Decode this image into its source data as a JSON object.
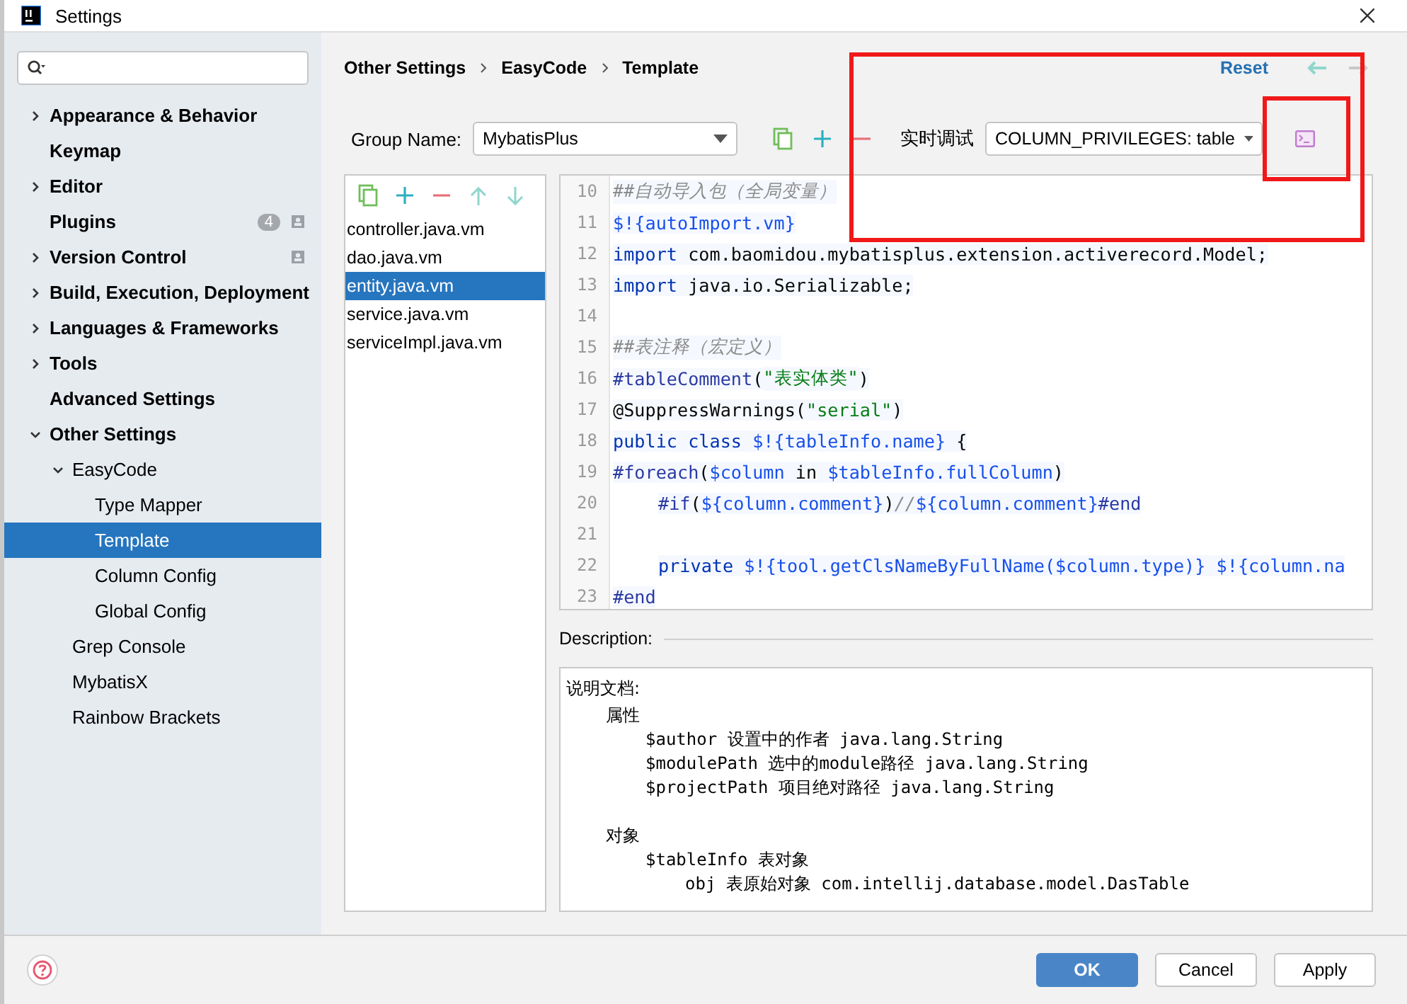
{
  "window": {
    "title": "Settings"
  },
  "sidebar": {
    "items": [
      {
        "label": "Appearance & Behavior",
        "expanded": false,
        "selected": false
      },
      {
        "label": "Keymap",
        "selected": false
      },
      {
        "label": "Editor",
        "expanded": false,
        "selected": false
      },
      {
        "label": "Plugins",
        "selected": false,
        "scoped": true,
        "badge": "4"
      },
      {
        "label": "Version Control",
        "expanded": false,
        "selected": false,
        "scoped": true
      },
      {
        "label": "Build, Execution, Deployment",
        "expanded": false,
        "selected": false
      },
      {
        "label": "Languages & Frameworks",
        "expanded": false,
        "selected": false
      },
      {
        "label": "Tools",
        "expanded": false,
        "selected": false
      },
      {
        "label": "Advanced Settings",
        "selected": false
      },
      {
        "label": "Other Settings",
        "expanded": true,
        "selected": false,
        "children": [
          {
            "label": "EasyCode",
            "expanded": true,
            "selected": false,
            "children": [
              {
                "label": "Type Mapper",
                "selected": false
              },
              {
                "label": "Template",
                "selected": true
              },
              {
                "label": "Column Config",
                "selected": false
              },
              {
                "label": "Global Config",
                "selected": false
              }
            ]
          },
          {
            "label": "Grep Console",
            "selected": false
          },
          {
            "label": "MybatisX",
            "selected": false
          },
          {
            "label": "Rainbow Brackets",
            "selected": false
          }
        ]
      }
    ]
  },
  "breadcrumb": [
    "Other Settings",
    "EasyCode",
    "Template"
  ],
  "reset": "Reset",
  "group": {
    "label": "Group Name:",
    "value": "MybatisPlus"
  },
  "debug": {
    "label": "实时调试",
    "value": "COLUMN_PRIVILEGES: table",
    "highlighted": true,
    "run_highlighted": true
  },
  "files": [
    {
      "name": "controller.java.vm",
      "selected": false
    },
    {
      "name": "dao.java.vm",
      "selected": false
    },
    {
      "name": "entity.java.vm",
      "selected": true
    },
    {
      "name": "service.java.vm",
      "selected": false
    },
    {
      "name": "serviceImpl.java.vm",
      "selected": false
    }
  ],
  "editor": {
    "lines": [
      {
        "number": "10",
        "tokens": [
          {
            "kind": "comment",
            "text": "##自动导入包（全局变量）"
          }
        ]
      },
      {
        "number": "11",
        "tokens": [
          {
            "kind": "variable",
            "text": "$!{autoImport.vm}"
          }
        ]
      },
      {
        "number": "12",
        "tokens": [
          {
            "kind": "keyword",
            "text": "import"
          },
          {
            "kind": "plain",
            "text": " com.baomidou.mybatisplus.extension.activerecord.Model;"
          }
        ]
      },
      {
        "number": "13",
        "tokens": [
          {
            "kind": "keyword",
            "text": "import"
          },
          {
            "kind": "plain",
            "text": " java.io.Serializable;"
          }
        ]
      },
      {
        "number": "14"
      },
      {
        "number": "15",
        "tokens": [
          {
            "kind": "comment",
            "text": "##表注释（宏定义）"
          }
        ]
      },
      {
        "number": "16",
        "tokens": [
          {
            "kind": "directive",
            "text": "#tableComment"
          },
          {
            "kind": "plain",
            "text": "("
          },
          {
            "kind": "string",
            "text": "\"表实体类\""
          },
          {
            "kind": "plain",
            "text": ")"
          }
        ]
      },
      {
        "number": "17",
        "tokens": [
          {
            "kind": "plain",
            "text": "@SuppressWarnings("
          },
          {
            "kind": "string",
            "text": "\"serial\""
          },
          {
            "kind": "plain",
            "text": ")"
          }
        ]
      },
      {
        "number": "18",
        "tokens": [
          {
            "kind": "keyword",
            "text": "public class "
          },
          {
            "kind": "variable",
            "text": "$!{tableInfo.name}"
          },
          {
            "kind": "plain",
            "text": " {"
          }
        ]
      },
      {
        "number": "19",
        "tokens": [
          {
            "kind": "directive",
            "text": "#foreach"
          },
          {
            "kind": "plain",
            "text": "("
          },
          {
            "kind": "variable",
            "text": "$column"
          },
          {
            "kind": "plain",
            "text": " in "
          },
          {
            "kind": "variable",
            "text": "$tableInfo.fullColumn"
          },
          {
            "kind": "plain",
            "text": ")"
          }
        ]
      },
      {
        "number": "20",
        "indented": true,
        "tokens": [
          {
            "kind": "directive",
            "text": "#if"
          },
          {
            "kind": "plain",
            "text": "("
          },
          {
            "kind": "variable",
            "text": "${column.comment}"
          },
          {
            "kind": "plain",
            "text": ")"
          },
          {
            "kind": "comment",
            "text": "//"
          },
          {
            "kind": "variable",
            "text": "${column.comment}"
          },
          {
            "kind": "directive",
            "text": "#end"
          }
        ]
      },
      {
        "number": "21"
      },
      {
        "number": "22",
        "indented": true,
        "tokens": [
          {
            "kind": "keyword",
            "text": "private "
          },
          {
            "kind": "variable",
            "text": "$!{tool.getClsNameByFullName($column.type)}"
          },
          {
            "kind": "variable",
            "text": " $!{column.na"
          }
        ]
      },
      {
        "number": "23",
        "tokens": [
          {
            "kind": "directive",
            "text": "#end"
          }
        ]
      }
    ]
  },
  "description": {
    "label": "Description:",
    "heading": "说明文档:",
    "items": [
      {
        "text": "属性",
        "children": [
          {
            "text": "$author 设置中的作者 java.lang.String"
          },
          {
            "text": "$modulePath 选中的module路径 java.lang.String"
          },
          {
            "text": "$projectPath 项目绝对路径 java.lang.String"
          }
        ]
      },
      {
        "text": "对象",
        "children": [
          {
            "text": "$tableInfo 表对象",
            "children": [
              {
                "text": "obj 表原始对象 com.intellij.database.model.DasTable"
              }
            ]
          }
        ]
      }
    ]
  },
  "buttons": [
    {
      "label": "OK",
      "kind": "primary"
    },
    {
      "label": "Cancel",
      "kind": "normal"
    },
    {
      "label": "Apply",
      "kind": "normal"
    }
  ]
}
